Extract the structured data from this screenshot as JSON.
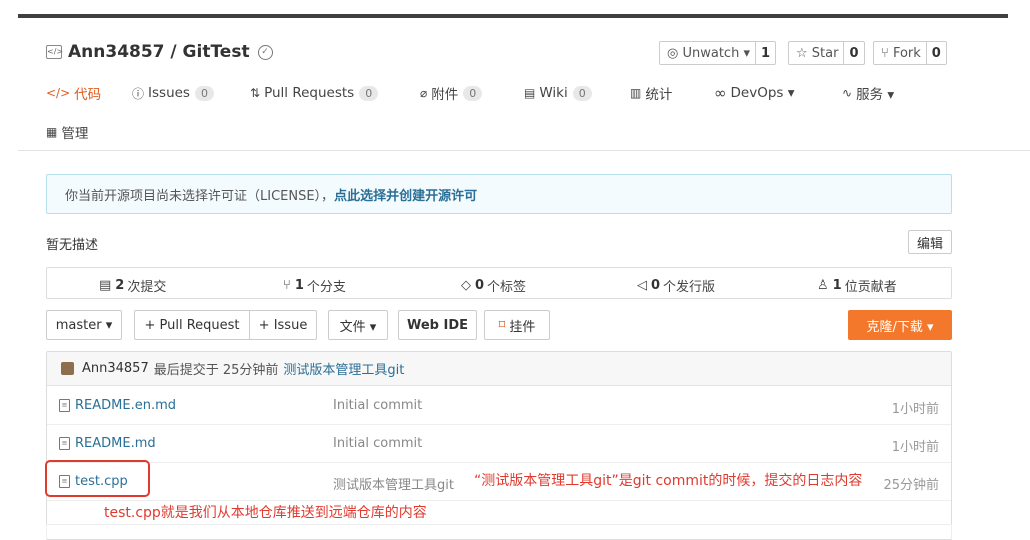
{
  "repo": {
    "title": "Ann34857 / GitTest",
    "unwatch_label": "Unwatch ▾",
    "unwatch_count": "1",
    "star_label": "Star",
    "star_count": "0",
    "fork_label": "Fork",
    "fork_count": "0"
  },
  "nav": {
    "code": "代码",
    "issues": "Issues",
    "issues_count": "0",
    "pulls": "Pull Requests",
    "pulls_count": "0",
    "attach": "附件",
    "attach_count": "0",
    "wiki": "Wiki",
    "wiki_count": "0",
    "stats": "统计",
    "devops": "DevOps ▾",
    "services": "服务 ▾",
    "manage": "管理"
  },
  "notice": {
    "text": "你当前开源项目尚未选择许可证（LICENSE），",
    "link": "点此选择并创建开源许可"
  },
  "description": "暂无描述",
  "edit_label": "编辑",
  "stats": {
    "commits_num": "2",
    "commits_label": "次提交",
    "branches_num": "1",
    "branches_label": "个分支",
    "tags_num": "0",
    "tags_label": "个标签",
    "releases_num": "0",
    "releases_label": "个发行版",
    "contributors_num": "1",
    "contributors_label": "位贡献者"
  },
  "toolbar": {
    "branch": "master ▾",
    "pull_request": "+ Pull Request",
    "issue": "+ Issue",
    "file": "文件 ▾",
    "web_ide": "Web IDE",
    "plugin": "挂件",
    "clone": "克隆/下载 ▾"
  },
  "commit": {
    "author": "Ann34857",
    "info": "最后提交于 25分钟前",
    "message": "测试版本管理工具git"
  },
  "files": [
    {
      "name": "README.en.md",
      "message": "Initial commit",
      "time": "1小时前"
    },
    {
      "name": "README.md",
      "message": "Initial commit",
      "time": "1小时前"
    },
    {
      "name": "test.cpp",
      "message": "测试版本管理工具git",
      "time": "25分钟前"
    }
  ],
  "annotations": {
    "commit_note": "“测试版本管理工具git”是git commit的时候，提交的日志内容",
    "file_note": "test.cpp就是我们从本地仓库推送到远端仓库的内容"
  },
  "colors": {
    "accent": "#e25a1c",
    "link": "#2a6f97",
    "clone_button": "#f3782b",
    "annotation": "#e03a2f"
  },
  "icons": {
    "repo": "repo-icon",
    "badge": "verified-badge-icon",
    "eye": "eye-icon",
    "star": "star-icon",
    "fork": "fork-icon",
    "code": "code-icon",
    "issue": "issue-icon",
    "pull": "pull-request-icon",
    "attach": "paperclip-icon",
    "wiki": "book-icon",
    "stats": "bar-chart-icon",
    "devops": "infinity-icon",
    "services": "pulse-icon",
    "manage": "clipboard-icon",
    "file": "file-icon"
  }
}
